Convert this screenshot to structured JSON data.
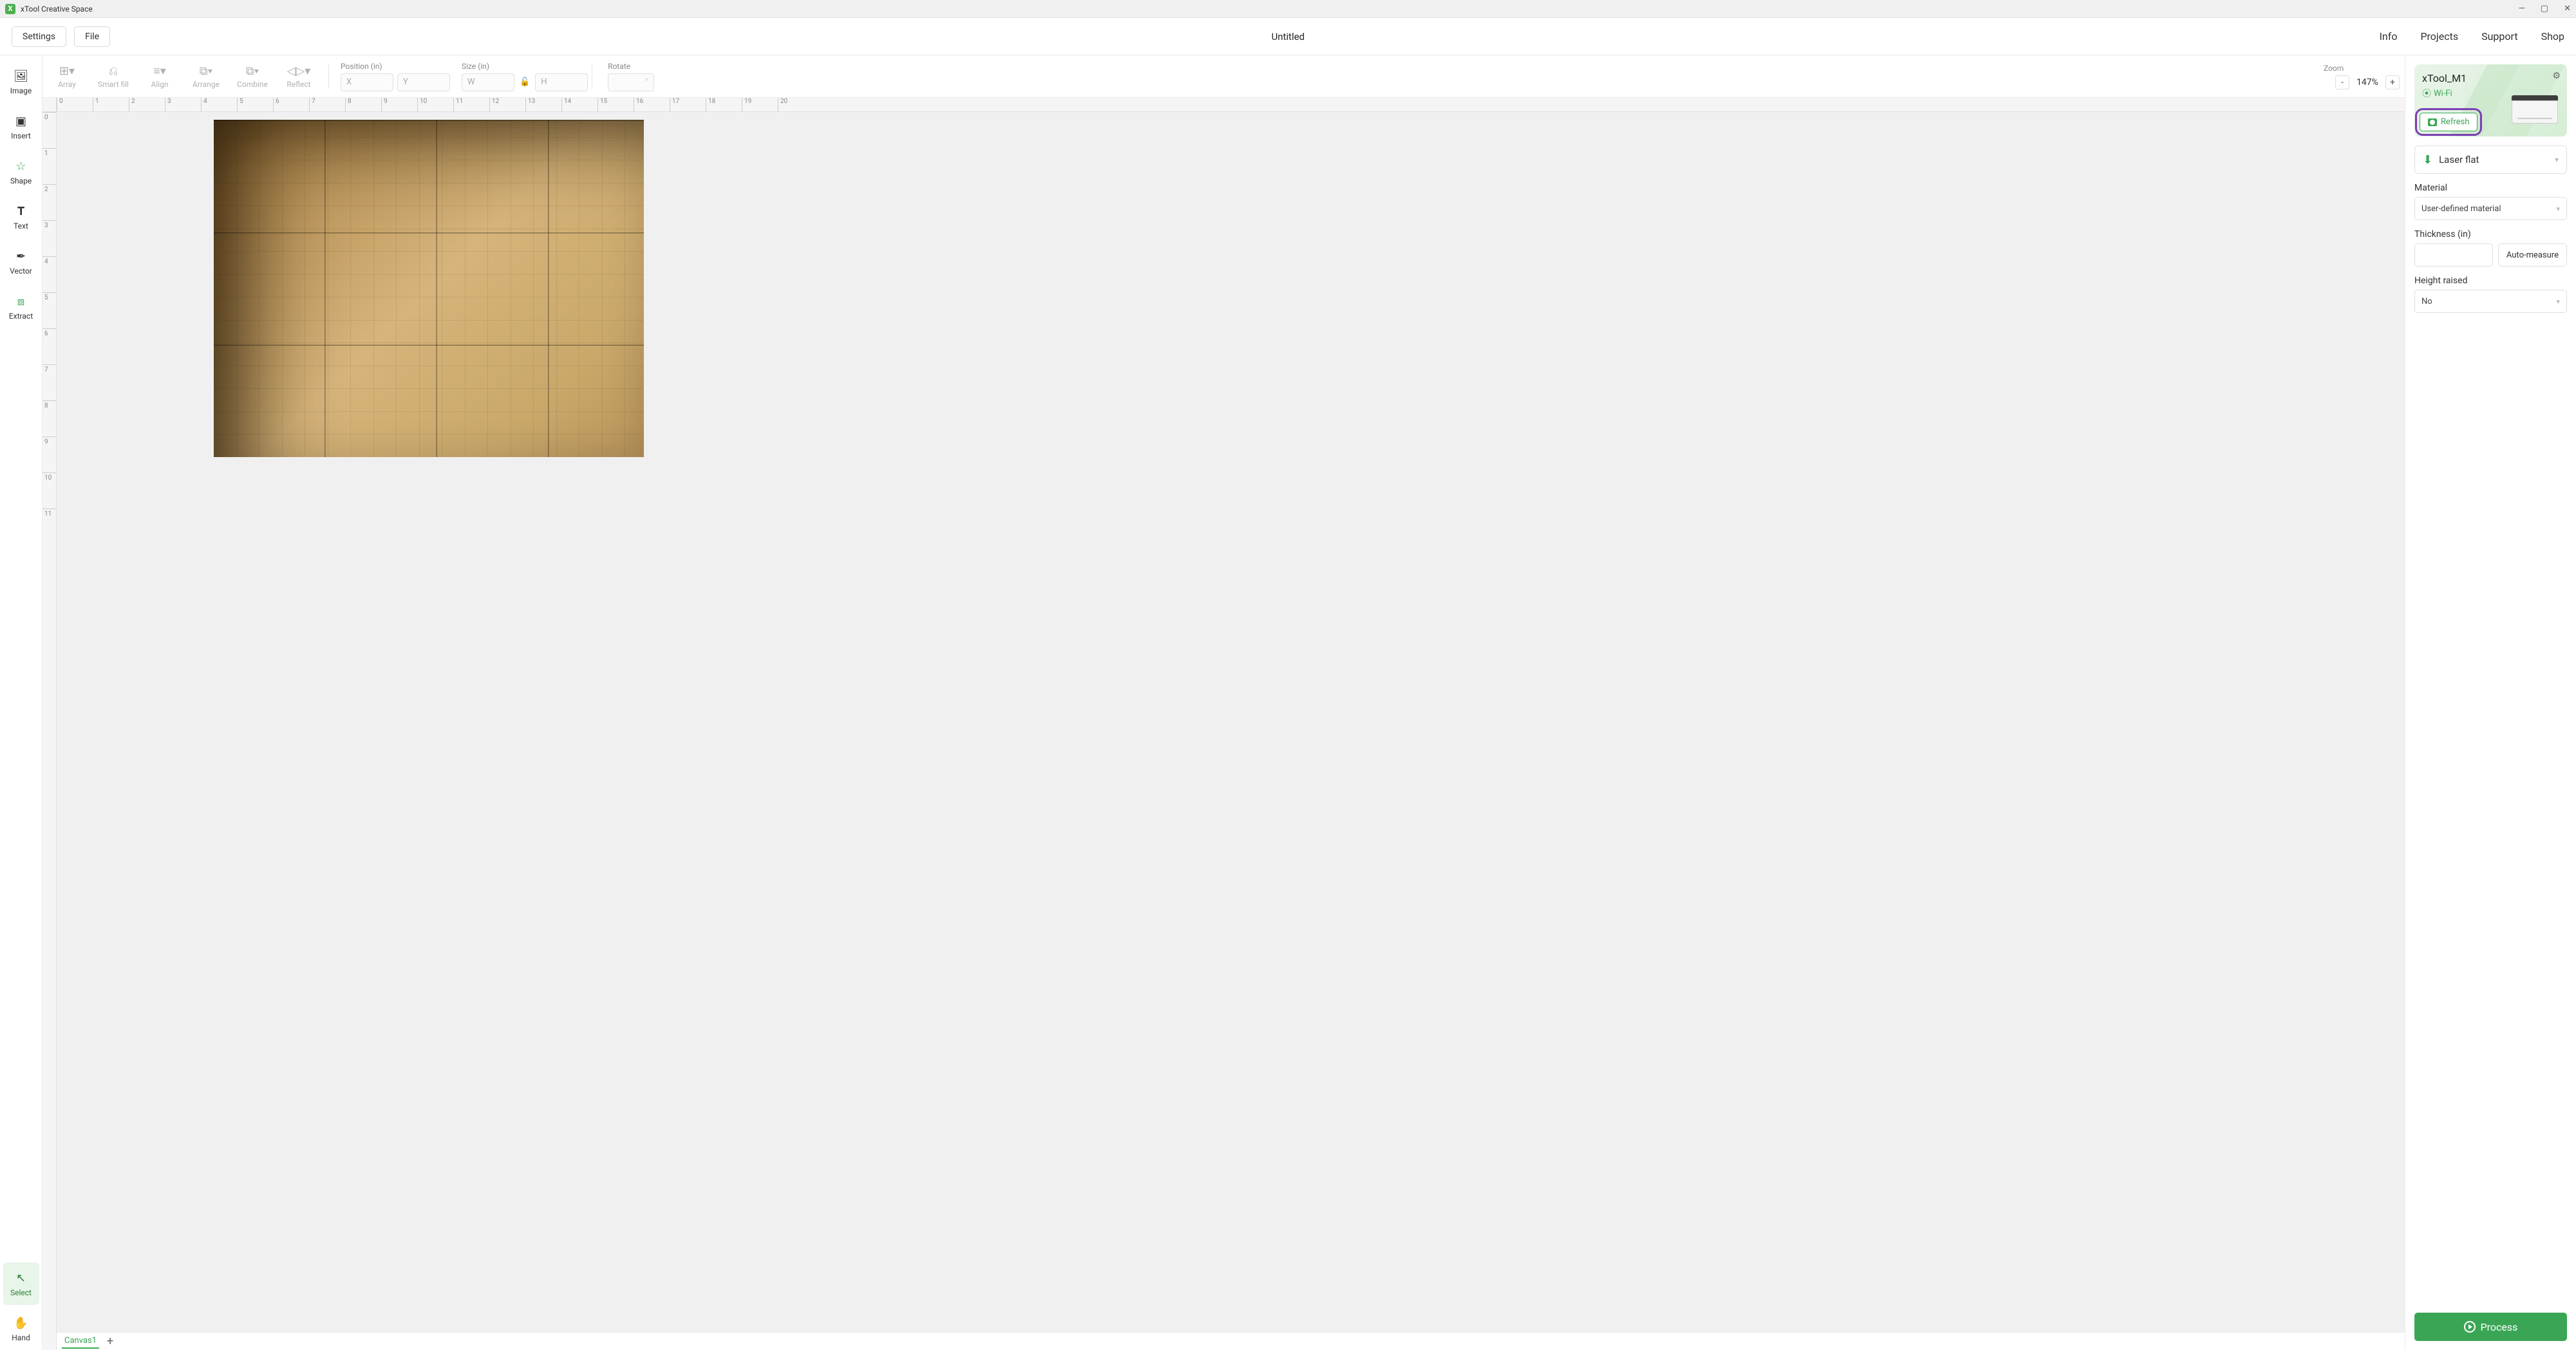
{
  "titlebar": {
    "app_name": "xTool Creative Space"
  },
  "menubar": {
    "settings": "Settings",
    "file": "File",
    "doc_title": "Untitled",
    "links": {
      "info": "Info",
      "projects": "Projects",
      "support": "Support",
      "shop": "Shop"
    }
  },
  "left_tools": {
    "image": "Image",
    "insert": "Insert",
    "shape": "Shape",
    "text": "Text",
    "vector": "Vector",
    "extract": "Extract",
    "select": "Select",
    "hand": "Hand"
  },
  "secondary": {
    "array": "Array",
    "smartfill": "Smart fill",
    "align": "Align",
    "arrange": "Arrange",
    "combine": "Combine",
    "reflect": "Reflect",
    "position_label": "Position (in)",
    "x_ph": "X",
    "y_ph": "Y",
    "size_label": "Size (in)",
    "w_ph": "W",
    "h_ph": "H",
    "rotate_label": "Rotate",
    "zoom_label": "Zoom",
    "zoom_value": "147%"
  },
  "ruler_h": [
    "0",
    "1",
    "2",
    "3",
    "4",
    "5",
    "6",
    "7",
    "8",
    "9",
    "10",
    "11",
    "12",
    "13",
    "14",
    "15",
    "16",
    "17",
    "18",
    "19",
    "20"
  ],
  "ruler_v": [
    "0",
    "1",
    "2",
    "3",
    "4",
    "5",
    "6",
    "7",
    "8",
    "9",
    "10",
    "11"
  ],
  "tabs": {
    "canvas1": "Canvas1"
  },
  "device": {
    "name": "xTool_M1",
    "conn": "Wi-Fi",
    "refresh": "Refresh"
  },
  "mode": {
    "label": "Laser flat"
  },
  "material": {
    "label": "Material",
    "value": "User-defined material"
  },
  "thickness": {
    "label": "Thickness (in)",
    "auto": "Auto-measure"
  },
  "height_raised": {
    "label": "Height raised",
    "value": "No"
  },
  "process": "Process"
}
